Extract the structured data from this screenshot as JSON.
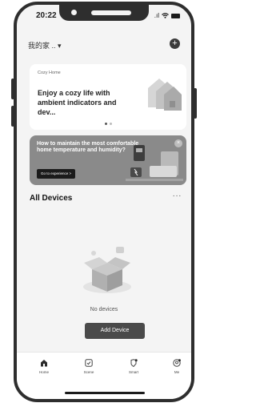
{
  "status_bar": {
    "time": "20:22",
    "signal_glyph": ".ıl"
  },
  "header": {
    "home_name": "我的家 .. ▾",
    "add_icon": "+"
  },
  "banner_card": {
    "tag": "Cozy Home",
    "message": "Enjoy a cozy life with ambient indicators and dev..."
  },
  "promo_card": {
    "message": "How to maintain the most comfortable home temperature and humidity?",
    "button_label": "Go to experience >",
    "close_icon": "×"
  },
  "devices": {
    "title": "All Devices",
    "more_icon": "···",
    "empty_text": "No devices",
    "add_button": "Add Device"
  },
  "tabs": [
    {
      "label": "Home",
      "icon": "home-icon",
      "active": true
    },
    {
      "label": "Scene",
      "icon": "scene-icon",
      "active": false
    },
    {
      "label": "Smart",
      "icon": "smart-icon",
      "active": false
    },
    {
      "label": "Me",
      "icon": "me-icon",
      "active": false
    }
  ],
  "colors": {
    "background": "#f4f4f4",
    "card": "#ffffff",
    "promo": "#8a8a8a",
    "button": "#4a4a4a"
  }
}
